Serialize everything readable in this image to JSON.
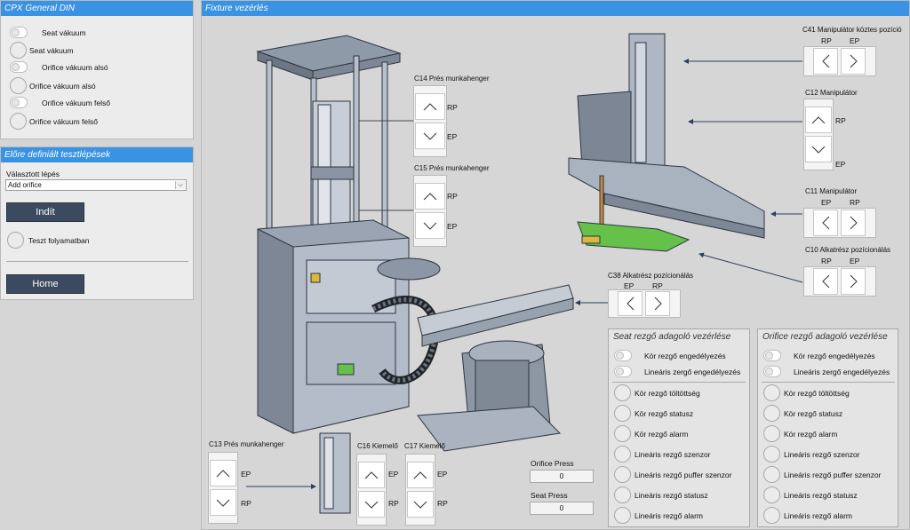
{
  "cpx": {
    "title": "CPX General DIN",
    "items": [
      "Seat vákuum",
      "Seat vákuum",
      "Orifice vákuum alsó",
      "Orifice vákuum alsó",
      "Orifice vákuum felső",
      "Orifice vákuum felső"
    ]
  },
  "tests": {
    "title": "Előre definiált tesztlépések",
    "selected_label": "Választott lépés",
    "selected_value": "Add orifice",
    "start_button": "Indít",
    "status_label": "Teszt folyamatban",
    "home_button": "Home"
  },
  "fixture": {
    "title": "Fixture vezérlés",
    "c14": {
      "title": "C14 Prés munkahenger",
      "label1": "RP",
      "label2": "EP"
    },
    "c15": {
      "title": "C15 Prés munkahenger",
      "label1": "RP",
      "label2": "EP"
    },
    "c41": {
      "title": "C41 Manipulátor köztes pozíció",
      "left": "RP",
      "right": "EP"
    },
    "c12": {
      "title": "C12 Manipulátor",
      "label1": "RP",
      "label2": "EP"
    },
    "c11": {
      "title": "C11 Manipulátor",
      "left": "EP",
      "right": "RP"
    },
    "c10": {
      "title": "C10 Alkatrész pozícionálás",
      "left": "RP",
      "right": "EP"
    },
    "c38": {
      "title": "C38 Alkatrész pozícionálás",
      "left": "EP",
      "right": "RP"
    },
    "c13": {
      "title": "C13 Prés munkahenger",
      "label1": "EP",
      "label2": "RP"
    },
    "c16": {
      "title": "C16 Kiemelő",
      "label1": "EP",
      "label2": "RP"
    },
    "c17": {
      "title": "C17 Kiemelő"
    },
    "orifice_press": {
      "label": "Orifice Press",
      "value": "0"
    },
    "seat_press": {
      "label": "Seat Press",
      "value": "0"
    }
  },
  "seat_feeder": {
    "title": "Seat rezgő adagoló vezérlése",
    "toggles": [
      "Kör rezgő engedélyezés",
      "Lineáris zergő engedélyezés"
    ],
    "leds": [
      "Kör rezgő töltöttség",
      "Kör rezgő statusz",
      "Kör rezgő alarm",
      "Lineáris rezgő szenzor",
      "Lineáris rezgő puffer szenzor",
      "Lineáris rezgő statusz",
      "Lineáris rezgő alarm"
    ]
  },
  "orifice_feeder": {
    "title": "Orifice rezgő adagoló vezérlése",
    "toggles": [
      "Kör rezgő engedélyezés",
      "Lineáris zergő engedélyezés"
    ],
    "leds": [
      "Kör rezgő töltöttség",
      "Kör rezgő statusz",
      "Kör rezgő alarm",
      "Lineáris rezgő szenzor",
      "Lineáris rezgő puffer szenzor",
      "Lineáris rezgő statusz",
      "Lineáris rezgő alarm"
    ]
  }
}
